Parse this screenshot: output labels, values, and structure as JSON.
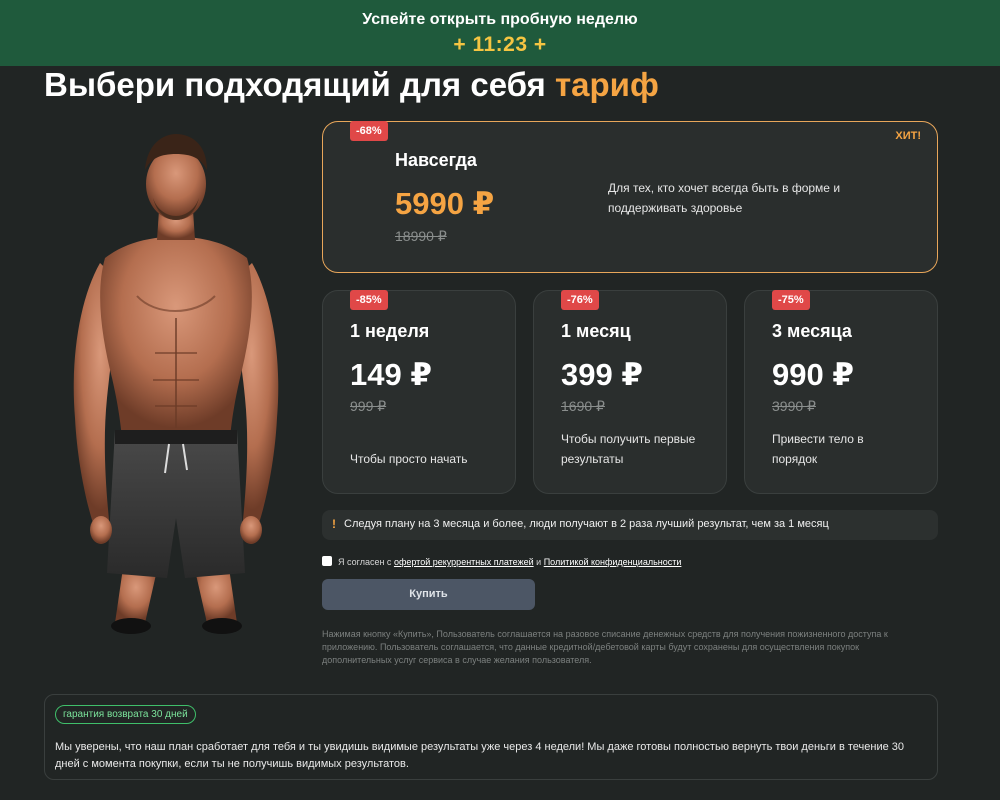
{
  "promo": {
    "title": "Успейте открыть пробную неделю",
    "timer": "+ 11:23 +"
  },
  "heading": {
    "main": "Выбери подходящий для себя",
    "accent": "тариф"
  },
  "plans": [
    {
      "discount": "-68%",
      "tag": "ХИТ!",
      "name": "Навсегда",
      "price": "5990 ₽",
      "old_price": "18990 ₽",
      "description": "Для тех, кто хочет всегда быть в форме и поддерживать здоровье"
    },
    {
      "discount": "-85%",
      "name": "1 неделя",
      "price": "149 ₽",
      "old_price": "999 ₽",
      "description": "Чтобы просто начать"
    },
    {
      "discount": "-76%",
      "name": "1 месяц",
      "price": "399 ₽",
      "old_price": "1690 ₽",
      "description": "Чтобы получить первые результаты"
    },
    {
      "discount": "-75%",
      "name": "3 месяца",
      "price": "990 ₽",
      "old_price": "3990 ₽",
      "description": "Привести тело в порядок"
    }
  ],
  "tip": {
    "icon": "!",
    "text": "Следуя плану на 3 месяца и более, люди получают в 2 раза лучший результат, чем за 1 месяц"
  },
  "agreement": {
    "checked": false,
    "prefix": "Я согласен с",
    "link1": "офертой рекуррентных платежей",
    "and": "и",
    "link2": "Политикой конфиденциальности"
  },
  "buy_label": "Купить",
  "legal": "Нажимая кнопку «Купить», Пользователь соглашается на разовое списание денежных средств для получения пожизненного доступа к приложению. Пользователь соглашается, что данные кредитной/дебетовой карты будут сохранены для осуществления покупок дополнительных услуг сервиса в случае желания пользователя.",
  "guarantee": {
    "badge": "гарантия возврата 30 дней",
    "text": "Мы уверены, что наш план сработает для тебя и ты увидишь видимые результаты уже через 4 недели! Мы даже готовы полностью вернуть твои деньги в течение 30 дней с момента покупки, если ты не получишь видимых результатов."
  },
  "colors": {
    "accent": "#f5a443",
    "promo_bg": "#1f5a3c",
    "badge": "#e04848",
    "guarantee": "#3fbf6a"
  }
}
